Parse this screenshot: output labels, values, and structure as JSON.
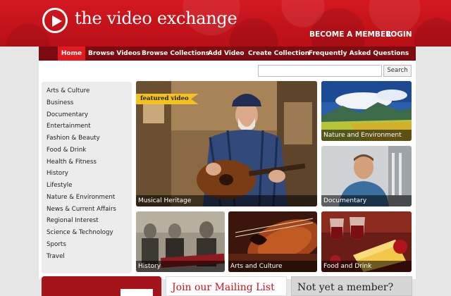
{
  "header": {
    "logo_text": "the video exchange",
    "become_member": "BECOME A MEMBER",
    "login": "LOGIN"
  },
  "nav": {
    "items": [
      "Home",
      "Browse Videos",
      "Browse Collections",
      "Add Video",
      "Create Collection",
      "Frequently Asked Questions"
    ],
    "active": "Home"
  },
  "search": {
    "value": "",
    "button": "Search"
  },
  "categories": [
    "Arts & Culture",
    "Business",
    "Documentary",
    "Entertainment",
    "Fashion & Beauty",
    "Food & Drink",
    "Health & Fitness",
    "History",
    "Lifestyle",
    "Nature & Environment",
    "News & Current Affairs",
    "Regional Interest",
    "Science & Technology",
    "Sports",
    "Travel"
  ],
  "featured": {
    "badge": "featured video",
    "label": "Musical Heritage"
  },
  "tiles": {
    "nature": "Nature and Environment",
    "documentary": "Documentary",
    "history": "History",
    "arts": "Arts and Culture",
    "food": "Food and Drink"
  },
  "bottom": {
    "mailing": "Join our Mailing List",
    "member": "Not yet a member?"
  },
  "colors": {
    "brand_red": "#c8141c",
    "nav_dark": "#7d0b10",
    "nav_active": "#e11a22",
    "badge_yellow": "#f2c21e"
  }
}
